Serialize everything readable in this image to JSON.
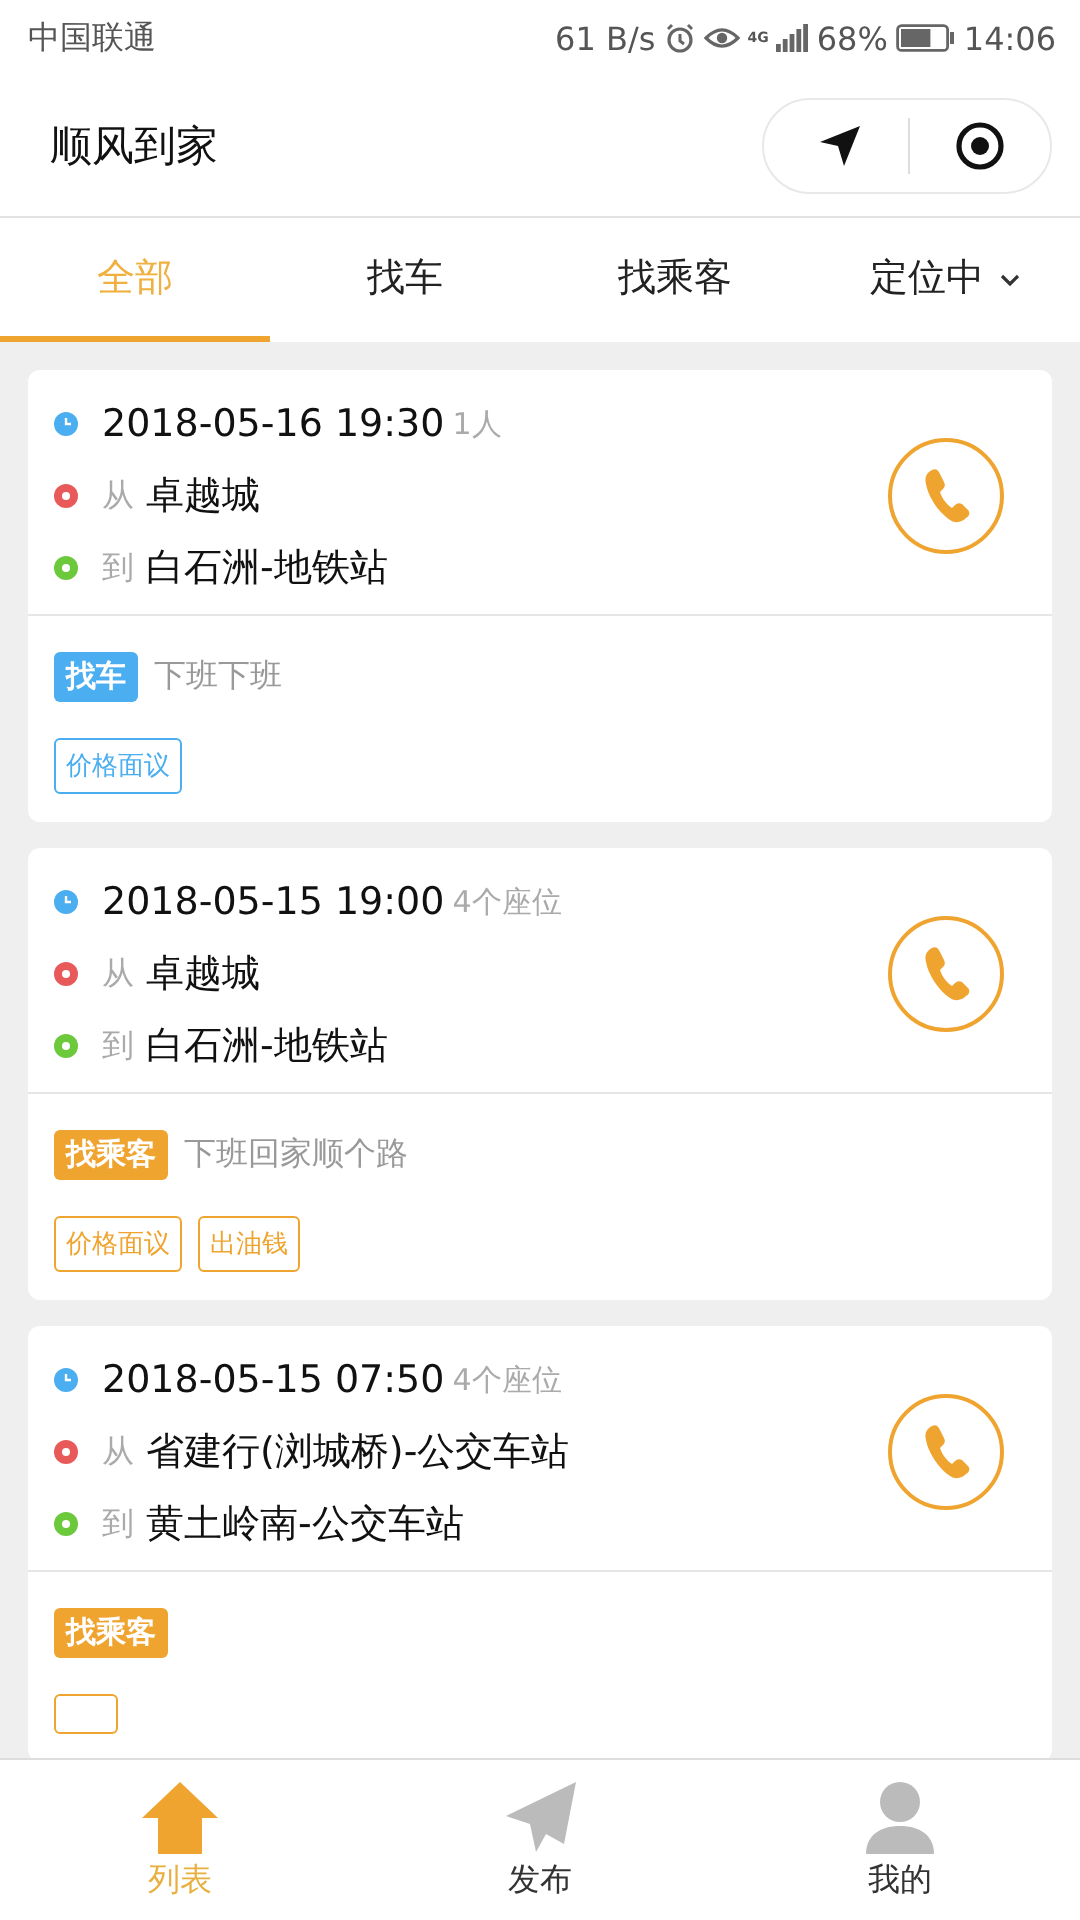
{
  "status_bar": {
    "carrier": "中国联通",
    "speed": "61 B/s",
    "network": "4G",
    "battery": "68%",
    "time": "14:06"
  },
  "header": {
    "title": "顺风到家"
  },
  "tabs": [
    {
      "label": "全部",
      "selected": true
    },
    {
      "label": "找车",
      "selected": false
    },
    {
      "label": "找乘客",
      "selected": false
    },
    {
      "label": "定位中",
      "selected": false,
      "kind": "dropdown"
    }
  ],
  "posts": [
    {
      "kind": "car",
      "datetime": "2018-05-16 19:30",
      "seats": "1人",
      "from_label": "从",
      "from": "卓越城",
      "to_label": "到",
      "to": "白石洲-地铁站",
      "type_tag": "找车",
      "note": "下班下班",
      "tags": [
        "价格面议"
      ]
    },
    {
      "kind": "passenger",
      "datetime": "2018-05-15 19:00",
      "seats": "4个座位",
      "from_label": "从",
      "from": "卓越城",
      "to_label": "到",
      "to": "白石洲-地铁站",
      "type_tag": "找乘客",
      "note": "下班回家顺个路",
      "tags": [
        "价格面议",
        "出油钱"
      ]
    },
    {
      "kind": "passenger",
      "datetime": "2018-05-15 07:50",
      "seats": "4个座位",
      "from_label": "从",
      "from": "省建行(浏城桥)-公交车站",
      "to_label": "到",
      "to": "黄土岭南-公交车站",
      "type_tag": "找乘客",
      "partial_tag": true
    }
  ],
  "bottom_nav": [
    {
      "label": "列表",
      "selected": true,
      "kind": "list"
    },
    {
      "label": "发布",
      "selected": false,
      "kind": "publish"
    },
    {
      "label": "我的",
      "selected": false,
      "kind": "profile"
    }
  ]
}
